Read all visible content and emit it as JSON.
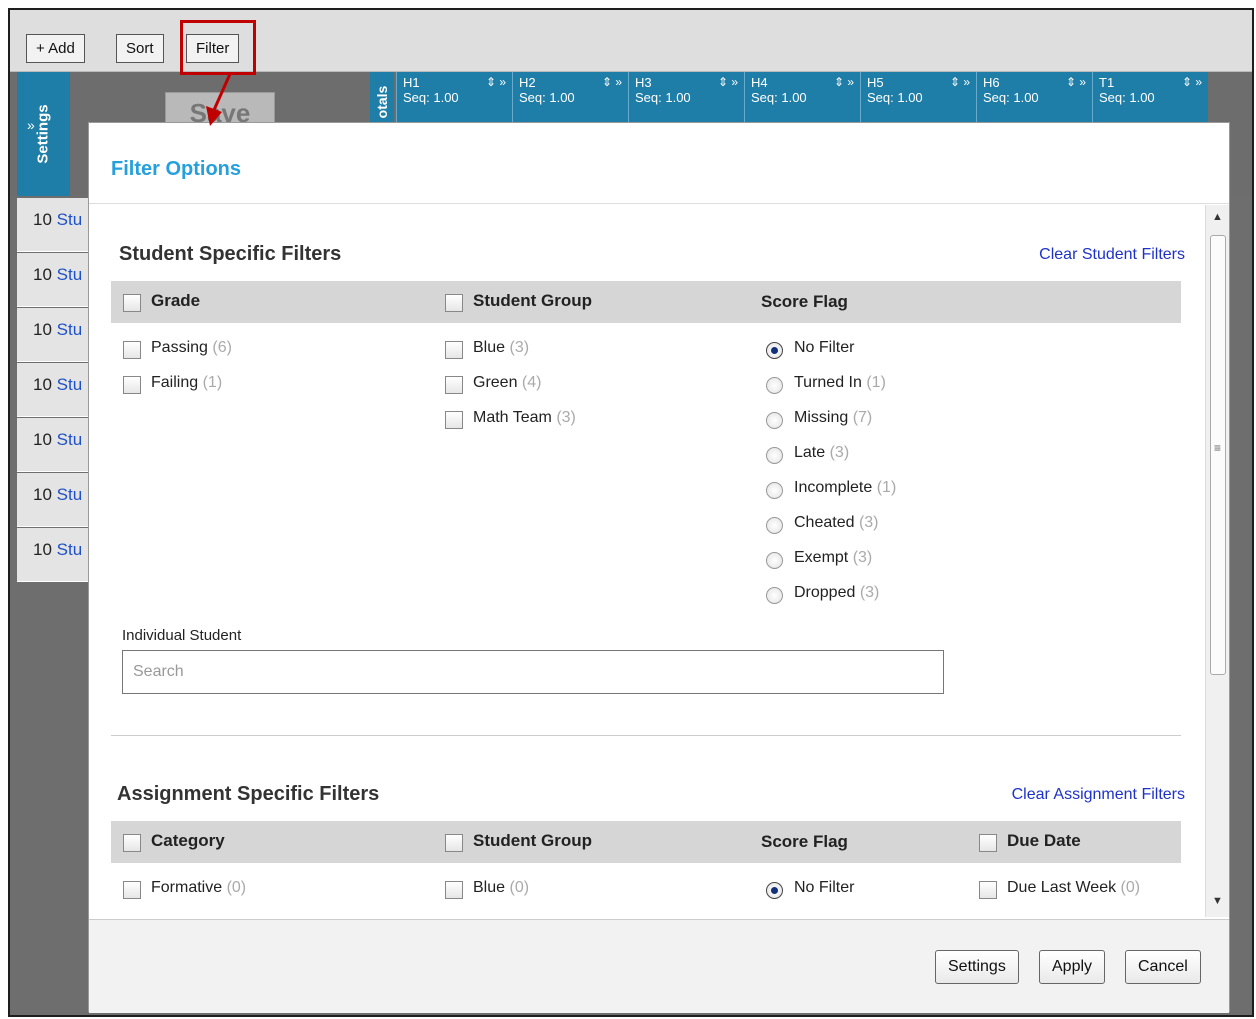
{
  "toolbar": {
    "add_label": "+ Add",
    "sort_label": "Sort",
    "filter_label": "Filter"
  },
  "background": {
    "settings_label": "Settings",
    "save_label": "Save",
    "totals_label": "otals",
    "columns": [
      {
        "name": "H1",
        "seq": "Seq: 1.00"
      },
      {
        "name": "H2",
        "seq": "Seq: 1.00"
      },
      {
        "name": "H3",
        "seq": "Seq: 1.00"
      },
      {
        "name": "H4",
        "seq": "Seq: 1.00"
      },
      {
        "name": "H5",
        "seq": "Seq: 1.00"
      },
      {
        "name": "H6",
        "seq": "Seq: 1.00"
      },
      {
        "name": "T1",
        "seq": "Seq: 1.00"
      }
    ],
    "row_prefix": "10",
    "row_text": "Stu"
  },
  "modal": {
    "title": "Filter Options",
    "student_section": {
      "title": "Student Specific Filters",
      "clear_label": "Clear Student Filters",
      "grade": {
        "header": "Grade",
        "options": [
          {
            "label": "Passing",
            "count": "(6)"
          },
          {
            "label": "Failing",
            "count": "(1)"
          }
        ]
      },
      "student_group": {
        "header": "Student Group",
        "options": [
          {
            "label": "Blue",
            "count": "(3)"
          },
          {
            "label": "Green",
            "count": "(4)"
          },
          {
            "label": "Math Team",
            "count": "(3)"
          }
        ]
      },
      "score_flag": {
        "header": "Score Flag",
        "options": [
          {
            "label": "No Filter",
            "count": ""
          },
          {
            "label": "Turned In",
            "count": "(1)"
          },
          {
            "label": "Missing",
            "count": "(7)"
          },
          {
            "label": "Late",
            "count": "(3)"
          },
          {
            "label": "Incomplete",
            "count": "(1)"
          },
          {
            "label": "Cheated",
            "count": "(3)"
          },
          {
            "label": "Exempt",
            "count": "(3)"
          },
          {
            "label": "Dropped",
            "count": "(3)"
          }
        ]
      },
      "individual_label": "Individual Student",
      "search_placeholder": "Search"
    },
    "assignment_section": {
      "title": "Assignment Specific Filters",
      "clear_label": "Clear Assignment Filters",
      "category_header": "Category",
      "student_group_header": "Student Group",
      "score_flag_header": "Score Flag",
      "due_date_header": "Due Date",
      "first_row": {
        "category": {
          "label": "Formative",
          "count": "(0)"
        },
        "group": {
          "label": "Blue",
          "count": "(0)"
        },
        "flag": {
          "label": "No Filter",
          "count": ""
        },
        "due": {
          "label": "Due Last Week",
          "count": "(0)"
        }
      }
    },
    "buttons": {
      "settings": "Settings",
      "apply": "Apply",
      "cancel": "Cancel"
    }
  },
  "colors": {
    "accent_blue": "#1f7ea8",
    "title_blue": "#25a0dc",
    "link_blue": "#1e32c8",
    "highlight_red": "#c00000"
  }
}
